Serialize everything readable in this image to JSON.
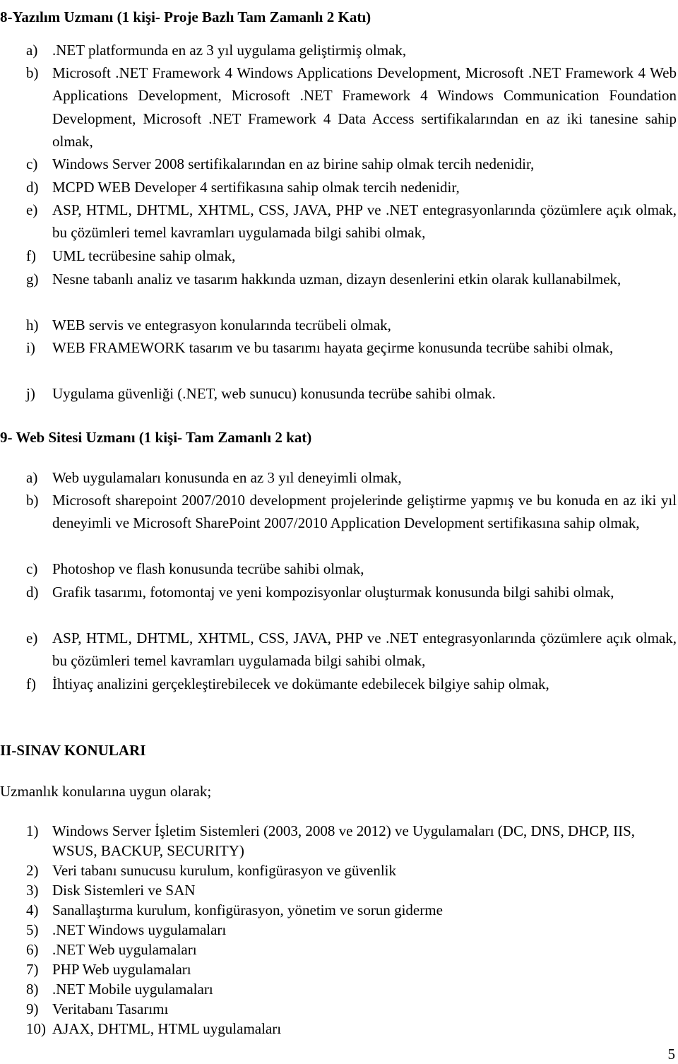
{
  "document": {
    "sections": [
      {
        "heading": "8-Yazılım Uzmanı (1 kişi- Proje Bazlı Tam Zamanlı 2 Katı)",
        "items": [
          {
            "marker": "a)",
            "text": ".NET platformunda en az 3 yıl uygulama geliştirmiş olmak,"
          },
          {
            "marker": "b)",
            "text": "Microsoft .NET Framework 4 Windows Applications Development, Microsoft .NET Framework 4 Web Applications Development, Microsoft .NET Framework 4 Windows Communication Foundation Development, Microsoft .NET Framework 4 Data Access sertifikalarından en az iki tanesine sahip olmak,"
          },
          {
            "marker": "c)",
            "text": "Windows Server 2008 sertifikalarından en az birine sahip olmak tercih nedenidir,"
          },
          {
            "marker": "d)",
            "text": "MCPD WEB Developer 4 sertifikasına sahip olmak tercih nedenidir,"
          },
          {
            "marker": "e)",
            "text": "ASP, HTML, DHTML, XHTML, CSS, JAVA, PHP ve .NET entegrasyonlarında çözümlere açık olmak, bu çözümleri temel kavramları uygulamada bilgi sahibi olmak,"
          },
          {
            "marker": "f)",
            "text": "UML tecrübesine sahip olmak,"
          },
          {
            "marker": "g)",
            "text": "Nesne tabanlı analiz ve tasarım hakkında uzman, dizayn desenlerini etkin olarak kullanabilmek,"
          },
          {
            "marker": "h)",
            "text": "WEB servis ve entegrasyon konularında tecrübeli olmak,"
          },
          {
            "marker": "i)",
            "text": "WEB FRAMEWORK tasarım ve bu tasarımı hayata geçirme konusunda tecrübe sahibi olmak,"
          },
          {
            "marker": "j)",
            "text": "Uygulama güvenliği (.NET, web sunucu) konusunda tecrübe sahibi olmak."
          }
        ]
      },
      {
        "heading": "9- Web Sitesi Uzmanı (1 kişi- Tam Zamanlı 2 kat)",
        "items": [
          {
            "marker": "a)",
            "text": "Web uygulamaları konusunda en az 3 yıl deneyimli olmak,"
          },
          {
            "marker": "b)",
            "text": "Microsoft sharepoint 2007/2010 development projelerinde geliştirme yapmış ve bu konuda en az iki yıl deneyimli ve Microsoft SharePoint 2007/2010 Application Development sertifikasına sahip olmak,"
          },
          {
            "marker": "c)",
            "text": "Photoshop ve flash konusunda tecrübe sahibi olmak,"
          },
          {
            "marker": "d)",
            "text": "Grafik tasarımı, fotomontaj ve yeni kompozisyonlar oluşturmak konusunda bilgi sahibi olmak,"
          },
          {
            "marker": "e)",
            "text": "ASP, HTML, DHTML, XHTML, CSS, JAVA, PHP ve .NET entegrasyonlarında çözümlere açık olmak, bu çözümleri temel kavramları uygulamada bilgi sahibi olmak,"
          },
          {
            "marker": "f)",
            "text": "İhtiyaç analizini gerçekleştirebilecek ve dokümante edebilecek bilgiye sahip olmak,"
          }
        ]
      }
    ],
    "exam": {
      "heading": "II-SINAV KONULARI",
      "intro": "Uzmanlık konularına uygun olarak;",
      "topics": [
        {
          "marker": "1)",
          "text": "Windows Server İşletim Sistemleri (2003, 2008 ve 2012) ve Uygulamaları (DC, DNS, DHCP, IIS, WSUS, BACKUP, SECURITY)"
        },
        {
          "marker": "2)",
          "text": "Veri tabanı sunucusu kurulum, konfigürasyon ve güvenlik"
        },
        {
          "marker": "3)",
          "text": "Disk Sistemleri ve SAN"
        },
        {
          "marker": "4)",
          "text": "Sanallaştırma kurulum, konfigürasyon, yönetim ve sorun giderme"
        },
        {
          "marker": "5)",
          "text": ".NET Windows uygulamaları"
        },
        {
          "marker": "6)",
          "text": ".NET Web uygulamaları"
        },
        {
          "marker": "7)",
          "text": "PHP Web uygulamaları"
        },
        {
          "marker": "8)",
          "text": ".NET Mobile uygulamaları"
        },
        {
          "marker": "9)",
          "text": "Veritabanı Tasarımı"
        },
        {
          "marker": "10)",
          "text": "AJAX, DHTML, HTML uygulamaları"
        }
      ]
    },
    "page_number": "5"
  }
}
